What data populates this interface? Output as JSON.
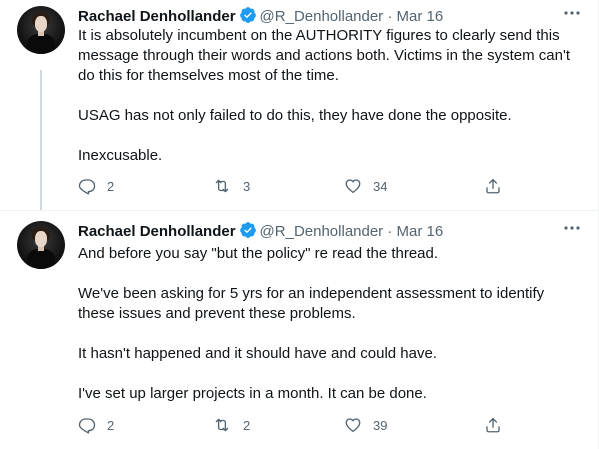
{
  "tweets": [
    {
      "author_name": "Rachael Denhollander",
      "handle": "@R_Denhollander",
      "separator": "·",
      "date": "Mar 16",
      "paragraphs": [
        "It is absolutely incumbent on the AUTHORITY figures to clearly send this message through their words and actions both. Victims in the system can't do this for themselves most of the time.",
        "USAG has not only failed to do this, they have done the opposite.",
        "Inexcusable."
      ],
      "replies": "2",
      "retweets": "3",
      "likes": "34"
    },
    {
      "author_name": "Rachael Denhollander",
      "handle": "@R_Denhollander",
      "separator": "·",
      "date": "Mar 16",
      "paragraphs": [
        "And before you say \"but the policy\" re read the thread.",
        "We've been asking for 5 yrs for an independent assessment to identify these issues and prevent these problems.",
        "It hasn't happened and it should have and could have.",
        "I've set up larger projects in a month. It can be done."
      ],
      "replies": "2",
      "retweets": "2",
      "likes": "39"
    }
  ],
  "colors": {
    "verified": "#1d9bf0",
    "secondary_text": "#536471",
    "thread_line": "#cfd9de",
    "divider": "#eff3f4"
  },
  "icons": [
    "verified-badge-icon",
    "more-icon",
    "reply-icon",
    "retweet-icon",
    "like-icon",
    "share-icon"
  ]
}
